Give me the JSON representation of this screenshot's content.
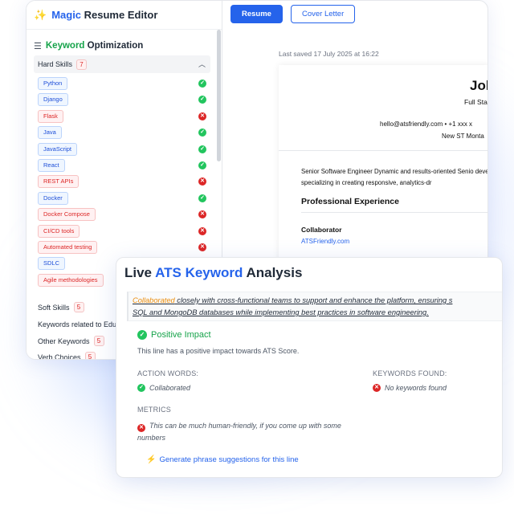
{
  "app": {
    "title_prefix": "Magic",
    "title_suffix": " Resume Editor",
    "opt_highlight": "Keyword",
    "opt_rest": " Optimization"
  },
  "hard_skills": {
    "label": "Hard Skills",
    "count": "7",
    "items": [
      {
        "name": "Python",
        "found": true
      },
      {
        "name": "Django",
        "found": true
      },
      {
        "name": "Flask",
        "found": false
      },
      {
        "name": "Java",
        "found": true
      },
      {
        "name": "JavaScript",
        "found": true
      },
      {
        "name": "React",
        "found": true
      },
      {
        "name": "REST APIs",
        "found": false
      },
      {
        "name": "Docker",
        "found": true
      },
      {
        "name": "Docker Compose",
        "found": false
      },
      {
        "name": "CI/CD tools",
        "found": false
      },
      {
        "name": "Automated testing",
        "found": false
      },
      {
        "name": "SDLC",
        "found": true
      },
      {
        "name": "Agile methodologies",
        "found": false
      }
    ]
  },
  "categories": {
    "soft_skills": {
      "label": "Soft Skills",
      "count": "5"
    },
    "education": {
      "label": "Keywords related to Edu"
    },
    "other": {
      "label": "Other Keywords",
      "count": "5"
    },
    "verbs": {
      "label": "Verb Choices",
      "count": "5"
    }
  },
  "tabs": {
    "resume": "Resume",
    "cover_letter": "Cover Letter"
  },
  "saved_text": "Last saved 17 July 2025 at 16:22",
  "resume": {
    "name": "Jol",
    "role": "Full Sta",
    "contact": "hello@atsfriendly.com   •   +1 xxx x",
    "address": "New ST Monta",
    "summary": "Senior Software Engineer Dynamic and results-oriented Senio development, specializing in creating responsive, analytics-dr",
    "section_title": "Professional Experience",
    "job_title": "Collaborator",
    "job_site": "ATSFriendly.com"
  },
  "ats": {
    "title_live": "Live ",
    "title_highlight": "ATS Keyword",
    "title_rest": " Analysis",
    "line_keyword": "Collaborated",
    "line_rest": " closely with cross-functional teams to support and enhance the platform, ensuring s",
    "line_2": "SQL and MongoDB databases while implementing best practices in software engineering.",
    "impact_title": "Positive Impact",
    "impact_desc": "This line has a positive impact towards ATS Score.",
    "action_label": "ACTION WORDS:",
    "action_value": "Collaborated",
    "keywords_label": "KEYWORDS FOUND:",
    "keywords_value": "No keywords found",
    "metrics_label": "METRICS",
    "metrics_value": "This can be much human-friendly, if you come up with some numbers",
    "generate_label": "Generate phrase suggestions for this line"
  },
  "colors": {
    "accent": "#2563eb",
    "success": "#22c55e",
    "error": "#dc2626",
    "highlight": "#ea8c0c"
  }
}
